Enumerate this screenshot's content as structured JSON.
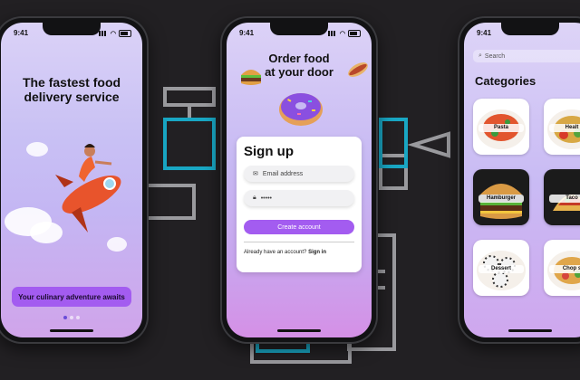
{
  "status": {
    "time": "9:41"
  },
  "onboarding": {
    "title": "The fastest food delivery service",
    "cta_label": "Your culinary adventure awaits"
  },
  "signup_screen": {
    "header_title": "Order food at your door",
    "form_title": "Sign up",
    "email_placeholder": "Email address",
    "password_value": "•••••",
    "create_button": "Create account",
    "have_account_text": "Already have an account?",
    "sign_in_link": "Sign in"
  },
  "categories_screen": {
    "search_placeholder": "Search",
    "title": "Categories",
    "items": [
      {
        "label": "Pasta"
      },
      {
        "label": "Healt"
      },
      {
        "label": "Hamburger"
      },
      {
        "label": "Taco"
      },
      {
        "label": "Dessert"
      },
      {
        "label": "Chop s"
      }
    ]
  },
  "colors": {
    "accent": "#a35cf0",
    "background": "#222023",
    "outline_teal": "#19a7c4",
    "outline_grey": "#9a9a9e"
  }
}
